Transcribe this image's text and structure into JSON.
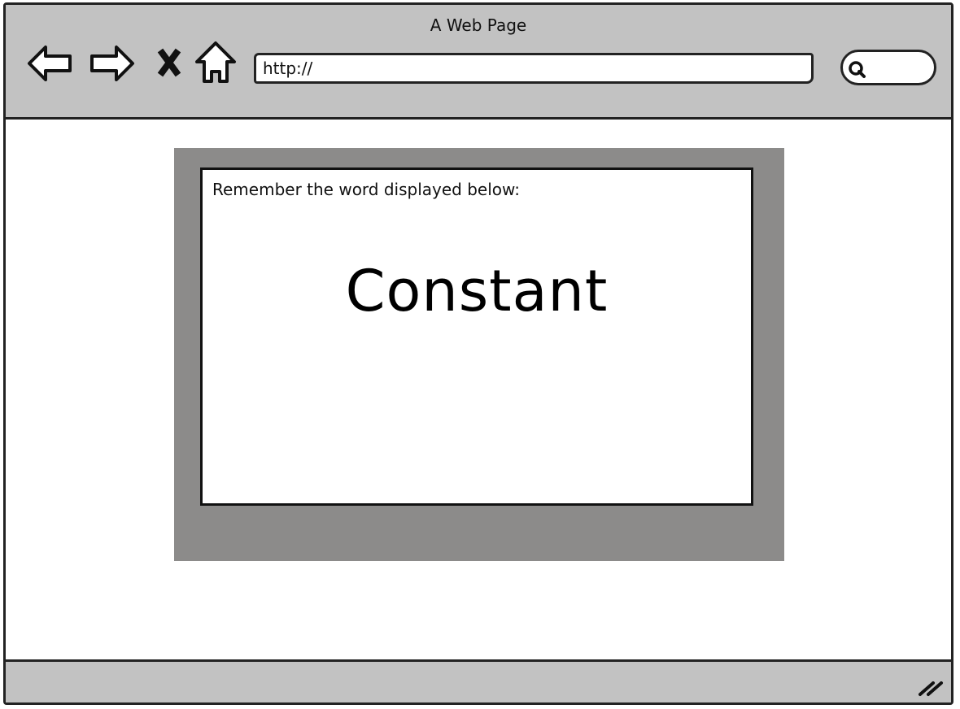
{
  "window": {
    "title": "A Web Page"
  },
  "toolbar": {
    "icons": [
      "back-arrow-icon",
      "forward-arrow-icon",
      "close-icon",
      "home-icon"
    ],
    "url": "http://",
    "search_icon": "search-icon"
  },
  "content": {
    "instruction": "Remember the word displayed below:",
    "word": "Constant"
  },
  "colors": {
    "chrome": "#c2c2c2",
    "frame": "#8c8b8a",
    "border": "#222222"
  }
}
